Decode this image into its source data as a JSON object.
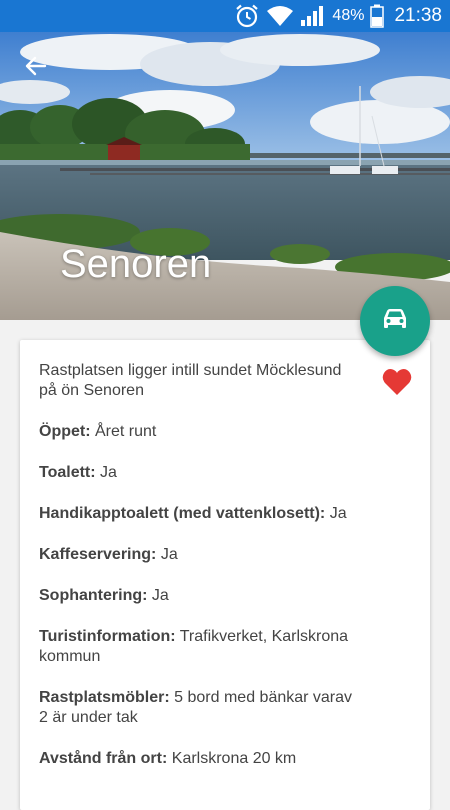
{
  "status_bar": {
    "battery_percent": "48%",
    "time": "21:38",
    "icons": [
      "alarm-icon",
      "wifi-icon",
      "signal-icon",
      "battery-icon"
    ],
    "color": "#1976d2"
  },
  "hero": {
    "title": "Senoren",
    "back_icon": "arrow-back-icon"
  },
  "fab": {
    "icon": "car-icon",
    "color": "#19a18a"
  },
  "favorite": {
    "icon": "heart-icon",
    "color": "#e53935"
  },
  "details": {
    "description": "Rastplatsen ligger intill sundet Möcklesund på ön Senoren",
    "items": [
      {
        "label": "Öppet:",
        "value": "Året runt"
      },
      {
        "label": "Toalett:",
        "value": "Ja"
      },
      {
        "label": "Handikapptoalett (med vattenklosett):",
        "value": "Ja"
      },
      {
        "label": "Kaffeservering:",
        "value": "Ja"
      },
      {
        "label": "Sophantering:",
        "value": "Ja"
      },
      {
        "label": "Turistinformation:",
        "value": "Trafikverket, Karlskrona kommun"
      },
      {
        "label": "Rastplatsmöbler:",
        "value": "5 bord med bänkar varav 2 är under tak"
      },
      {
        "label": "Avstånd från ort:",
        "value": "Karlskrona 20 km"
      }
    ]
  }
}
